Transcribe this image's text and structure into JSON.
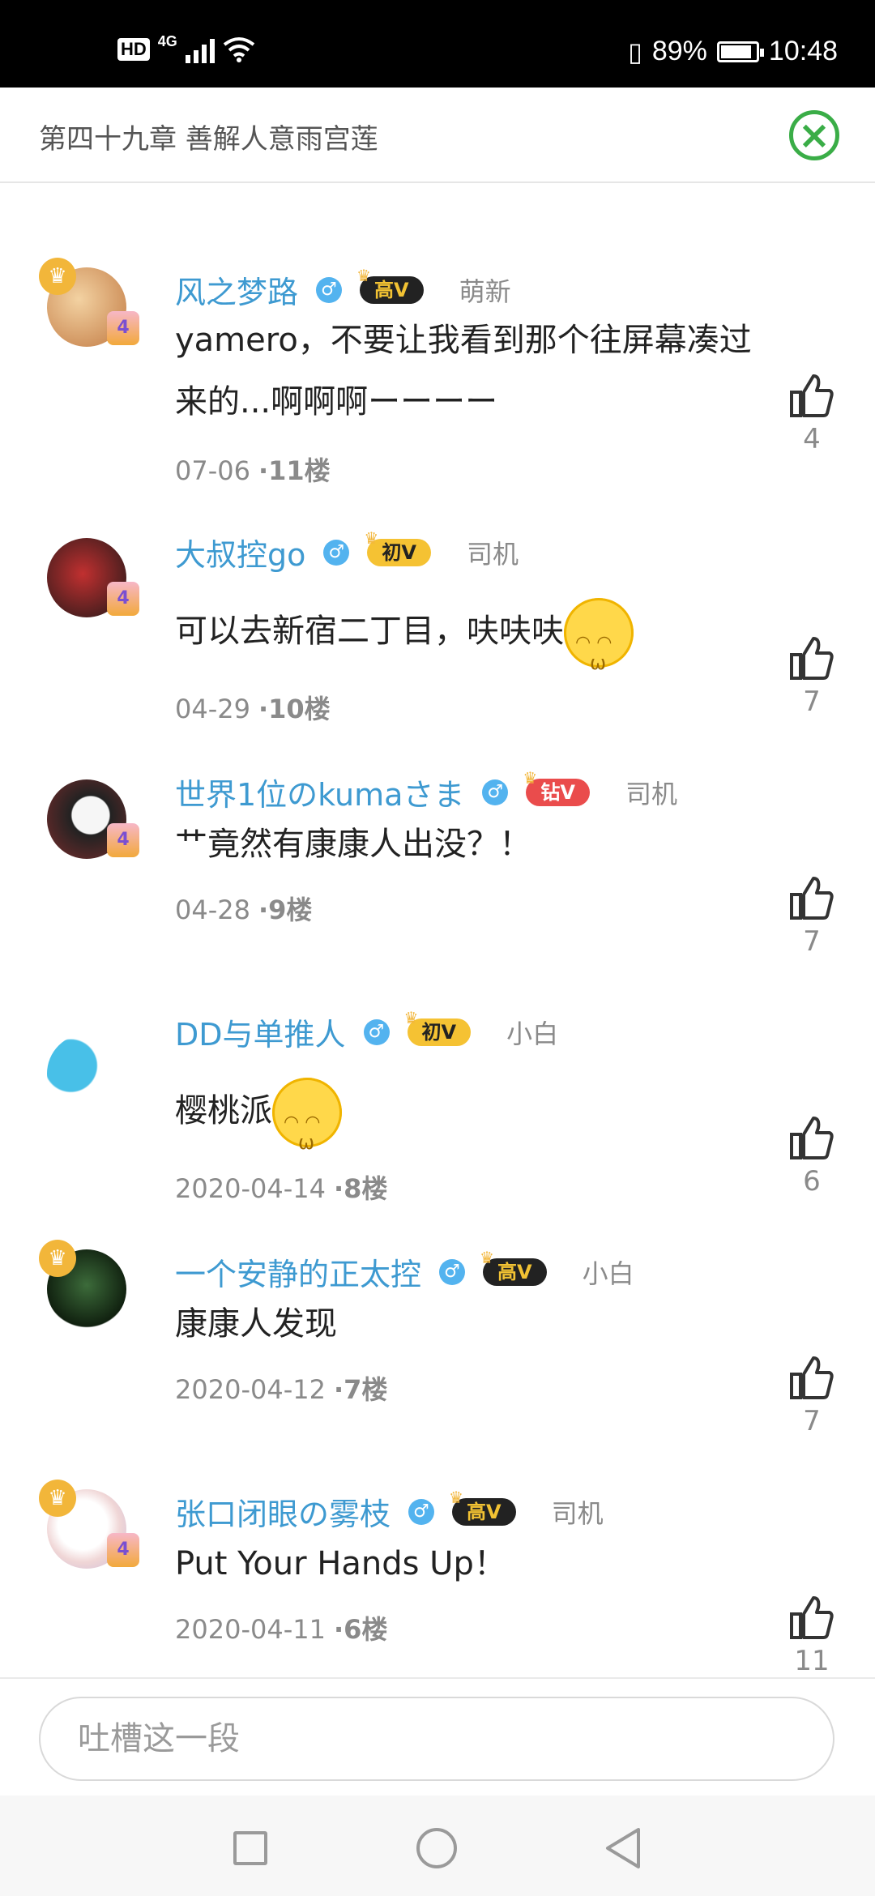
{
  "status_bar": {
    "network_type": "4G",
    "battery_text": "89%",
    "time": "10:48",
    "battery_level": 0.89
  },
  "header": {
    "title": "第四十九章 善解人意雨宫莲",
    "close_icon": "close-circle-icon"
  },
  "comments": [
    {
      "username": "风之梦路",
      "vip": "高V",
      "rank": "萌新",
      "content": "yamero，不要让我看到那个往屏幕凑过来的...啊啊啊ーーーー",
      "date": "07-06",
      "floor": "·11楼",
      "likes": "4"
    },
    {
      "username": "大叔控go",
      "vip": "初V",
      "rank": "司机",
      "content": "可以去新宿二丁目，呋呋呋",
      "date": "04-29",
      "floor": "·10楼",
      "likes": "7"
    },
    {
      "username": "世界1位のkumaさま",
      "vip": "钻V",
      "rank": "司机",
      "content": "艹竟然有康康人出没？！",
      "date": "04-28",
      "floor": "·9楼",
      "likes": "7"
    },
    {
      "username": "DD与单推人",
      "vip": "初V",
      "rank": "小白",
      "content": "樱桃派",
      "date": "2020-04-14",
      "floor": "·8楼",
      "likes": "6"
    },
    {
      "username": "一个安静的正太控",
      "vip": "高V",
      "rank": "小白",
      "content": "康康人发现",
      "date": "2020-04-12",
      "floor": "·7楼",
      "likes": "7"
    },
    {
      "username": "张口闭眼の雾枝",
      "vip": "高V",
      "rank": "司机",
      "content": "Put Your Hands Up！",
      "date": "2020-04-11",
      "floor": "·6楼",
      "likes": "11"
    }
  ],
  "level_badge": "4",
  "input": {
    "placeholder": "吐槽这一段"
  },
  "colors": {
    "accent_green": "#3aad47",
    "username_blue": "#3e9ad1"
  }
}
